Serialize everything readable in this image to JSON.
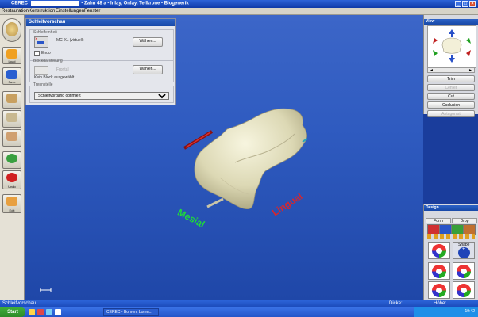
{
  "window": {
    "app_title": "CEREC",
    "doc_title": "- Zahn 48 a - Inlay, Onlay, Teilkrone - Biogenerik",
    "minimize": "_",
    "restore": "□",
    "close": "×"
  },
  "menu": {
    "items": [
      "Restauration",
      "Konstruktion",
      "Einstellungen",
      "Fenster"
    ]
  },
  "left_toolbar": {
    "buttons": [
      {
        "label": "Load"
      },
      {
        "label": "Save"
      },
      {
        "label": ""
      },
      {
        "label": ""
      },
      {
        "label": ""
      },
      {
        "label": ""
      },
      {
        "label": "Undo"
      },
      {
        "label": "Edit"
      }
    ]
  },
  "preview_panel": {
    "title": "Schleifvorschau",
    "unit_label": "Schleifeinheit",
    "unit_value": "MC-XL (virtuell)",
    "unit_button": "Wählen...",
    "endo_label": "Endo",
    "block_label": "Blockdarstellung",
    "block_value": "Frontal",
    "block_button": "Wählen...",
    "block_status": "Kein Block ausgewählt",
    "separator_label": "Trennstelle",
    "process_value": "Schleifvorgang optimiert"
  },
  "view_panel": {
    "title": "View",
    "buttons": [
      "Trim",
      "Center",
      "Cut",
      "Occlusion",
      "Antagonist"
    ],
    "nav_left": "◄",
    "nav_right": "►"
  },
  "scene": {
    "mesial_label": "Mesial",
    "lingual_label": "Lingual"
  },
  "design_panel": {
    "title": "Design",
    "tabs": [
      "Form",
      "Drop"
    ],
    "shape_label": "Shape",
    "plus_label": "+"
  },
  "statusbar": {
    "left": "Schleifvorschau",
    "thickness_label": "Dicke:",
    "height_label": "Höhe:"
  },
  "taskbar": {
    "start": "Start",
    "tasks": [
      "CEREC - Bohren, Loren..."
    ],
    "clock": "19:42"
  },
  "colors": {
    "viewport": "#2f5bc0",
    "tooth": "#e6e2c2",
    "mesial": "#1fd93a",
    "lingual": "#d8262c"
  }
}
